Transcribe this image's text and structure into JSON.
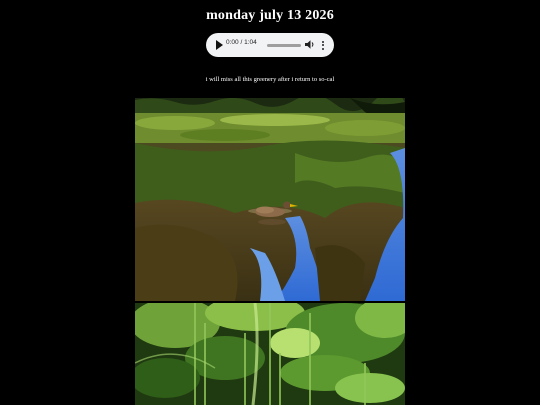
{
  "post": {
    "title": "monday july 13 2026",
    "caption": "i will miss all this greenery after i return to so-cal"
  },
  "audio_player": {
    "time_display": "0:00 / 1:04",
    "progress": 0.0,
    "volume_fraction": 0.6,
    "play_icon": "play-icon",
    "volume_icon": "volume-icon",
    "more_icon": "more-vertical-icon"
  },
  "photos": [
    {
      "subject": "duck swimming on a pond reflecting trees and blue sky"
    },
    {
      "subject": "close-up of large green leaves"
    }
  ],
  "colors": {
    "background": "#000000",
    "text": "#ffffff",
    "player_background": "#f1f3f4"
  }
}
